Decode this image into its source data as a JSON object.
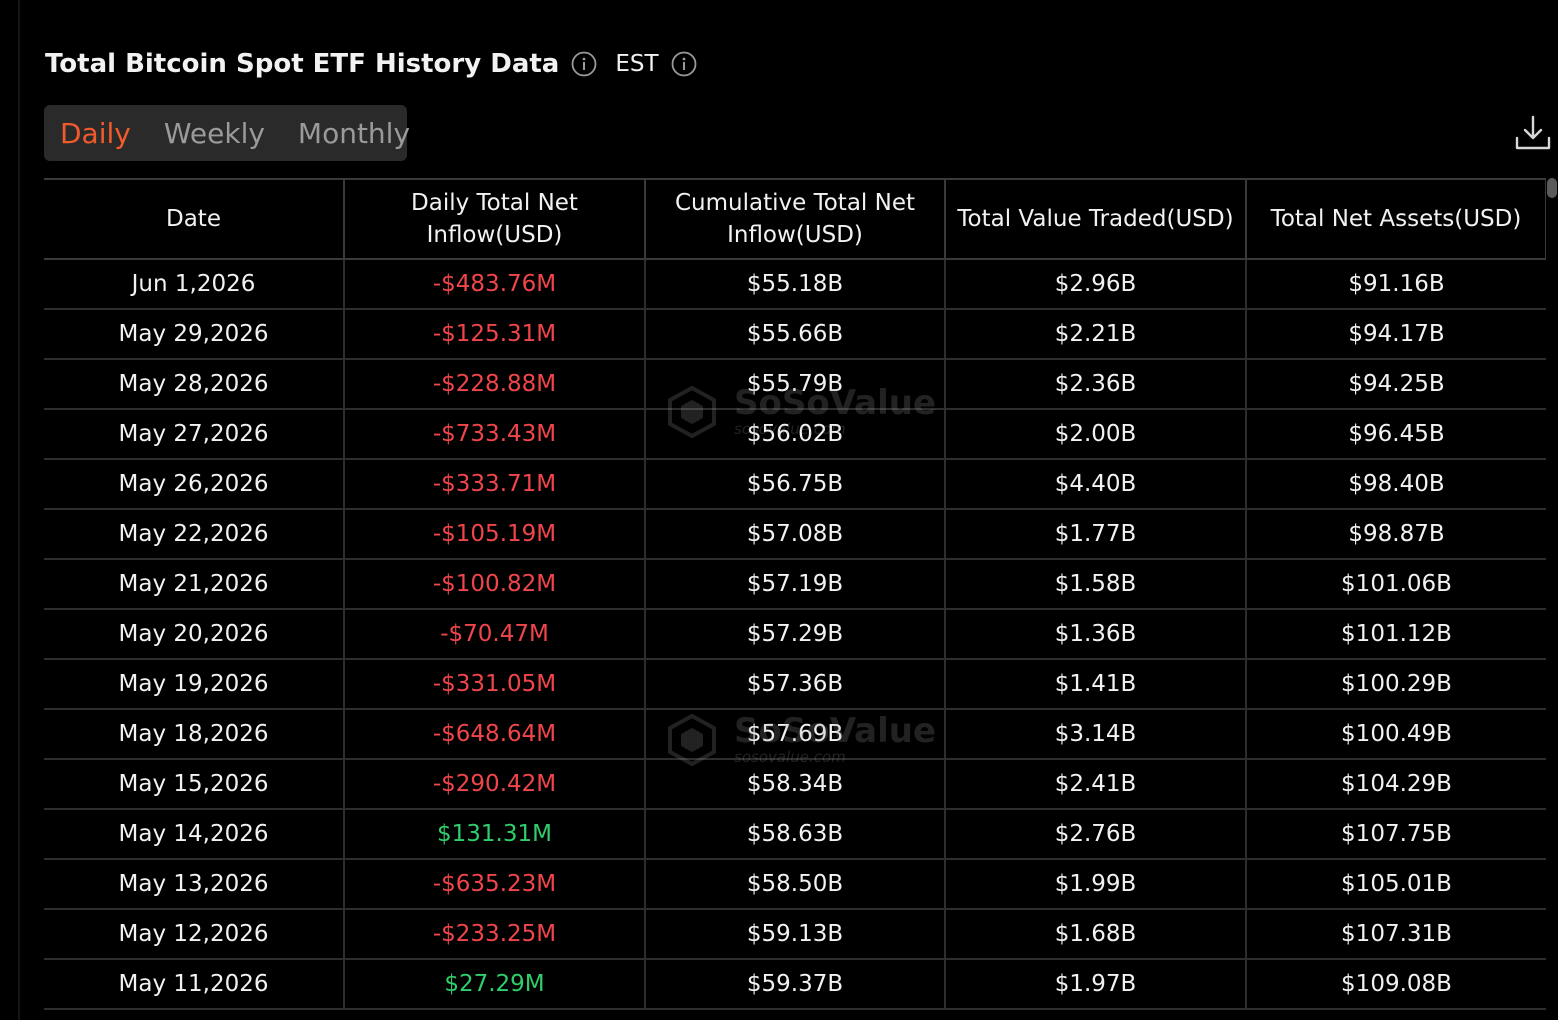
{
  "header": {
    "title": "Total Bitcoin Spot ETF History Data",
    "timezone": "EST",
    "info_icon": "info-circle-icon"
  },
  "tabs": [
    {
      "label": "Daily",
      "active": true
    },
    {
      "label": "Weekly",
      "active": false
    },
    {
      "label": "Monthly",
      "active": false
    }
  ],
  "toolbar": {
    "download_icon": "download-icon"
  },
  "colors": {
    "accent": "#f15a2b",
    "negative": "#f0454a",
    "positive": "#2fce6a",
    "background": "#000000"
  },
  "watermark": {
    "brand": "SoSoValue",
    "domain": "sosovalue.com"
  },
  "table": {
    "columns": [
      "Date",
      "Daily Total Net Inflow(USD)",
      "Cumulative Total Net Inflow(USD)",
      "Total Value Traded(USD)",
      "Total Net Assets(USD)"
    ],
    "rows": [
      {
        "date": "Jun 1,2026",
        "daily": "-$483.76M",
        "cumulative": "$55.18B",
        "traded": "$2.96B",
        "assets": "$91.16B"
      },
      {
        "date": "May 29,2026",
        "daily": "-$125.31M",
        "cumulative": "$55.66B",
        "traded": "$2.21B",
        "assets": "$94.17B"
      },
      {
        "date": "May 28,2026",
        "daily": "-$228.88M",
        "cumulative": "$55.79B",
        "traded": "$2.36B",
        "assets": "$94.25B"
      },
      {
        "date": "May 27,2026",
        "daily": "-$733.43M",
        "cumulative": "$56.02B",
        "traded": "$2.00B",
        "assets": "$96.45B"
      },
      {
        "date": "May 26,2026",
        "daily": "-$333.71M",
        "cumulative": "$56.75B",
        "traded": "$4.40B",
        "assets": "$98.40B"
      },
      {
        "date": "May 22,2026",
        "daily": "-$105.19M",
        "cumulative": "$57.08B",
        "traded": "$1.77B",
        "assets": "$98.87B"
      },
      {
        "date": "May 21,2026",
        "daily": "-$100.82M",
        "cumulative": "$57.19B",
        "traded": "$1.58B",
        "assets": "$101.06B"
      },
      {
        "date": "May 20,2026",
        "daily": "-$70.47M",
        "cumulative": "$57.29B",
        "traded": "$1.36B",
        "assets": "$101.12B"
      },
      {
        "date": "May 19,2026",
        "daily": "-$331.05M",
        "cumulative": "$57.36B",
        "traded": "$1.41B",
        "assets": "$100.29B"
      },
      {
        "date": "May 18,2026",
        "daily": "-$648.64M",
        "cumulative": "$57.69B",
        "traded": "$3.14B",
        "assets": "$100.49B"
      },
      {
        "date": "May 15,2026",
        "daily": "-$290.42M",
        "cumulative": "$58.34B",
        "traded": "$2.41B",
        "assets": "$104.29B"
      },
      {
        "date": "May 14,2026",
        "daily": "$131.31M",
        "cumulative": "$58.63B",
        "traded": "$2.76B",
        "assets": "$107.75B"
      },
      {
        "date": "May 13,2026",
        "daily": "-$635.23M",
        "cumulative": "$58.50B",
        "traded": "$1.99B",
        "assets": "$105.01B"
      },
      {
        "date": "May 12,2026",
        "daily": "-$233.25M",
        "cumulative": "$59.13B",
        "traded": "$1.68B",
        "assets": "$107.31B"
      },
      {
        "date": "May 11,2026",
        "daily": "$27.29M",
        "cumulative": "$59.37B",
        "traded": "$1.97B",
        "assets": "$109.08B"
      }
    ]
  }
}
